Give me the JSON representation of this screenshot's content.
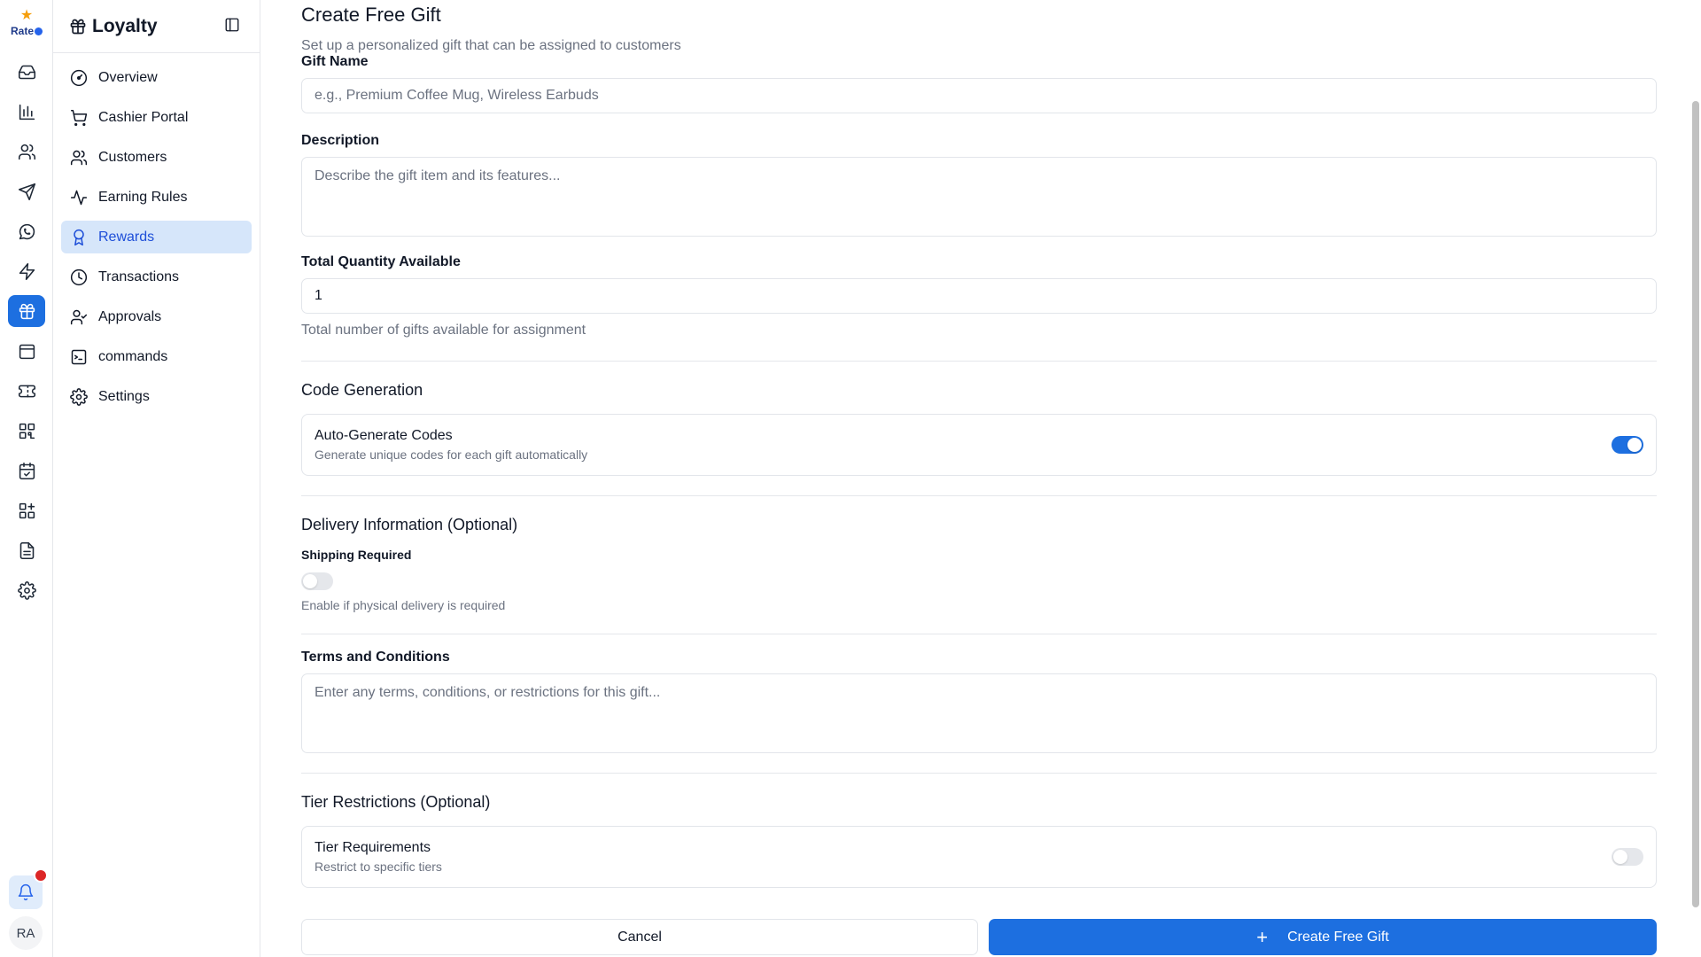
{
  "app": {
    "logo_text": "Rate"
  },
  "sidebar": {
    "title": "Loyalty",
    "items": [
      {
        "label": "Overview",
        "icon": "gauge-icon"
      },
      {
        "label": "Cashier Portal",
        "icon": "cart-icon"
      },
      {
        "label": "Customers",
        "icon": "users-icon"
      },
      {
        "label": "Earning Rules",
        "icon": "activity-icon"
      },
      {
        "label": "Rewards",
        "icon": "award-icon",
        "active": true
      },
      {
        "label": "Transactions",
        "icon": "clock-icon"
      },
      {
        "label": "Approvals",
        "icon": "user-check-icon"
      },
      {
        "label": "commands",
        "icon": "terminal-icon"
      },
      {
        "label": "Settings",
        "icon": "gear-icon"
      }
    ]
  },
  "user": {
    "initials": "RA"
  },
  "form": {
    "title": "Create Free Gift",
    "subtitle": "Set up a personalized gift that can be assigned to customers",
    "gift_name": {
      "label": "Gift Name",
      "placeholder": "e.g., Premium Coffee Mug, Wireless Earbuds",
      "value": ""
    },
    "description": {
      "label": "Description",
      "placeholder": "Describe the gift item and its features...",
      "value": ""
    },
    "quantity": {
      "label": "Total Quantity Available",
      "value": "1",
      "help": "Total number of gifts available for assignment"
    },
    "code_generation": {
      "section_title": "Code Generation",
      "auto_title": "Auto-Generate Codes",
      "auto_desc": "Generate unique codes for each gift automatically",
      "auto_enabled": true
    },
    "delivery": {
      "section_title": "Delivery Information (Optional)",
      "shipping_label": "Shipping Required",
      "shipping_enabled": false,
      "shipping_help": "Enable if physical delivery is required"
    },
    "terms": {
      "label": "Terms and Conditions",
      "placeholder": "Enter any terms, conditions, or restrictions for this gift...",
      "value": ""
    },
    "tiers": {
      "section_title": "Tier Restrictions (Optional)",
      "req_title": "Tier Requirements",
      "req_desc": "Restrict to specific tiers",
      "req_enabled": false
    },
    "actions": {
      "cancel": "Cancel",
      "submit": "Create Free Gift"
    }
  },
  "colors": {
    "accent": "#1d6fe0",
    "active_nav_bg": "#d6e6fa",
    "notification": "#dc2626"
  }
}
